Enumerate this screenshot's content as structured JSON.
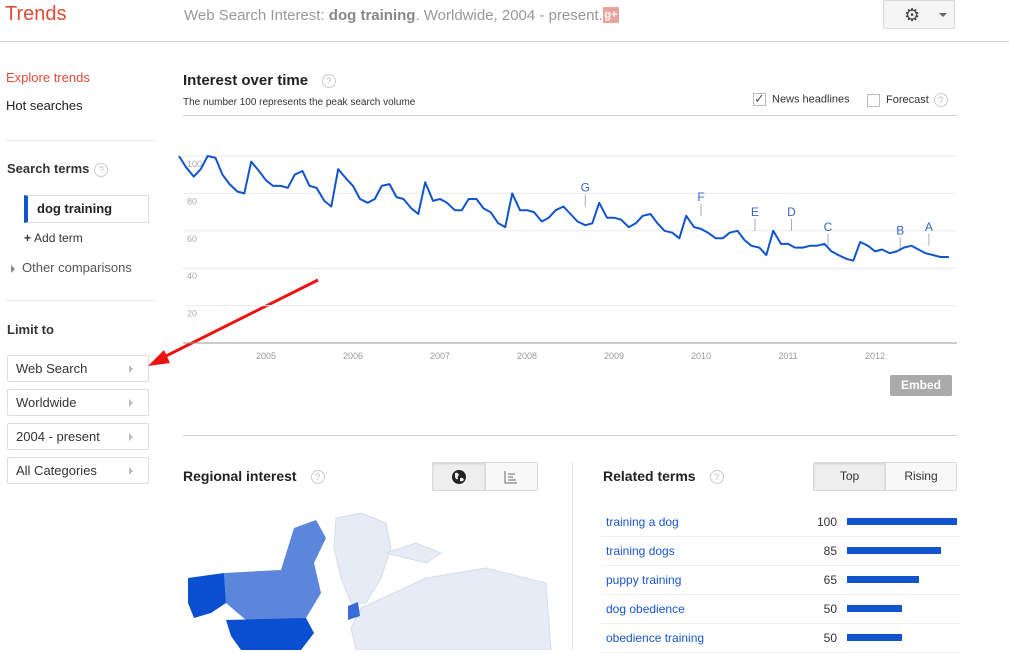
{
  "header": {
    "logo": "Trends",
    "title_prefix": "Web Search Interest: ",
    "title_term": "dog training",
    "title_suffix": ". Worldwide, 2004 - present.",
    "gplus_label": "g+",
    "settings_icon": "gear-icon"
  },
  "sidebar": {
    "explore": "Explore trends",
    "hot": "Hot searches",
    "search_terms_heading": "Search terms",
    "help": "?",
    "term": "dog training",
    "term_color": "#1155cc",
    "add_term": "Add term",
    "add_plus": "+",
    "other_comparisons": "Other comparisons",
    "limit_heading": "Limit to",
    "limits": [
      {
        "label": "Web Search"
      },
      {
        "label": "Worldwide"
      },
      {
        "label": "2004 - present"
      },
      {
        "label": "All Categories"
      }
    ]
  },
  "interest": {
    "title": "Interest over time",
    "subtitle": "The number 100 represents the peak search volume",
    "news_headlines": "News headlines",
    "news_checked": true,
    "forecast": "Forecast",
    "forecast_checked": false,
    "embed": "Embed"
  },
  "chart_data": {
    "type": "line",
    "title": "Interest over time",
    "xlabel": "",
    "ylabel": "",
    "ylim": [
      0,
      100
    ],
    "yticks": [
      20,
      40,
      60,
      80,
      100
    ],
    "xlim": [
      2004.0,
      2012.85
    ],
    "xticks": [
      2005,
      2006,
      2007,
      2008,
      2009,
      2010,
      2011,
      2012
    ],
    "grid": true,
    "color": "#1155cc",
    "series": [
      {
        "name": "dog training",
        "x": [
          2004.0,
          2004.08,
          2004.17,
          2004.25,
          2004.33,
          2004.42,
          2004.5,
          2004.58,
          2004.67,
          2004.75,
          2004.83,
          2004.92,
          2005.0,
          2005.08,
          2005.17,
          2005.25,
          2005.33,
          2005.42,
          2005.5,
          2005.58,
          2005.67,
          2005.75,
          2005.83,
          2005.92,
          2006.0,
          2006.08,
          2006.17,
          2006.25,
          2006.33,
          2006.42,
          2006.5,
          2006.58,
          2006.67,
          2006.75,
          2006.83,
          2006.92,
          2007.0,
          2007.08,
          2007.17,
          2007.25,
          2007.33,
          2007.42,
          2007.5,
          2007.58,
          2007.67,
          2007.75,
          2007.83,
          2007.92,
          2008.0,
          2008.08,
          2008.17,
          2008.25,
          2008.33,
          2008.42,
          2008.5,
          2008.58,
          2008.67,
          2008.75,
          2008.83,
          2008.92,
          2009.0,
          2009.08,
          2009.17,
          2009.25,
          2009.33,
          2009.42,
          2009.5,
          2009.58,
          2009.67,
          2009.75,
          2009.83,
          2009.92,
          2010.0,
          2010.08,
          2010.17,
          2010.25,
          2010.33,
          2010.42,
          2010.5,
          2010.58,
          2010.67,
          2010.75,
          2010.83,
          2010.92,
          2011.0,
          2011.08,
          2011.17,
          2011.25,
          2011.33,
          2011.42,
          2011.5,
          2011.58,
          2011.67,
          2011.75,
          2011.83,
          2011.92,
          2012.0,
          2012.08,
          2012.17,
          2012.25,
          2012.33,
          2012.42,
          2012.5,
          2012.58,
          2012.67,
          2012.75,
          2012.85
        ],
        "values": [
          100,
          94,
          89,
          93,
          100,
          99,
          90,
          85,
          81,
          80,
          97,
          92,
          87,
          84,
          84,
          83,
          90,
          92,
          84,
          83,
          76,
          73,
          93,
          88,
          84,
          77,
          75,
          77,
          84,
          85,
          78,
          77,
          72,
          69,
          86,
          76,
          77,
          75,
          71,
          71,
          77,
          77,
          72,
          70,
          64,
          62,
          80,
          71,
          71,
          70,
          65,
          67,
          71,
          73,
          69,
          65,
          63,
          64,
          75,
          67,
          67,
          66,
          62,
          64,
          68,
          69,
          64,
          60,
          59,
          56,
          68,
          62,
          61,
          59,
          56,
          56,
          59,
          60,
          55,
          52,
          51,
          47,
          60,
          53,
          53,
          51,
          51,
          52,
          52,
          53,
          49,
          47,
          45,
          44,
          54,
          52,
          49,
          50,
          48,
          49,
          51,
          52,
          50,
          48,
          47,
          46,
          46
        ]
      }
    ],
    "annotations": [
      {
        "label": "G",
        "x": 2008.67,
        "value": 73
      },
      {
        "label": "F",
        "x": 2010.0,
        "value": 68
      },
      {
        "label": "E",
        "x": 2010.62,
        "value": 60
      },
      {
        "label": "D",
        "x": 2011.04,
        "value": 60
      },
      {
        "label": "C",
        "x": 2011.46,
        "value": 52
      },
      {
        "label": "B",
        "x": 2012.29,
        "value": 50
      },
      {
        "label": "A",
        "x": 2012.62,
        "value": 52
      }
    ]
  },
  "regional": {
    "title": "Regional interest",
    "help": "?",
    "view_map_icon": "globe-icon",
    "view_list_icon": "list-icon"
  },
  "related": {
    "title": "Related terms",
    "help": "?",
    "tab_top": "Top",
    "tab_rising": "Rising",
    "bar_color": "#1155cc",
    "items": [
      {
        "label": "training a dog",
        "value": 100
      },
      {
        "label": "training dogs",
        "value": 85
      },
      {
        "label": "puppy training",
        "value": 65
      },
      {
        "label": "dog obedience",
        "value": 50
      },
      {
        "label": "obedience training",
        "value": 50
      }
    ]
  }
}
